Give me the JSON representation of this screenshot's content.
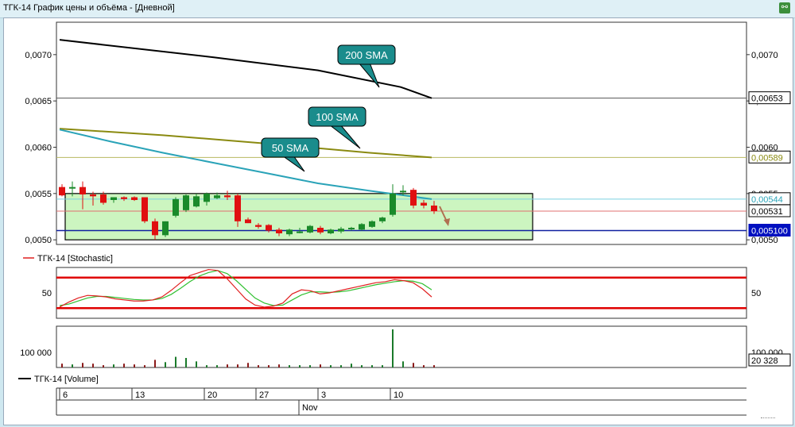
{
  "window": {
    "title": "ТГК-14 График цены и объёма - [Дневной]",
    "icon": "chart-link-icon"
  },
  "colors": {
    "up": "#1a8a2a",
    "down": "#e01010",
    "sma200": "#000000",
    "sma100": "#8a8a10",
    "sma50": "#2aa3b8",
    "box_fill": "#ccf5c0",
    "stoch_k": "#e02020",
    "stoch_d": "#30c030",
    "volume": "#8b1a1a",
    "volume_up": "#1a7a2a",
    "current_bg": "#0010c0"
  },
  "price_panel": {
    "y_ticks": [
      "0,0070",
      "0,0065",
      "0,0060",
      "0,0055",
      "0,0050"
    ],
    "y_range": [
      0.00495,
      0.00735
    ],
    "annotations": {
      "sma200": "200 SMA",
      "sma100": "100 SMA",
      "sma50": "50 SMA"
    },
    "price_tags": {
      "sma200": "0,00653",
      "sma100": "0,00589",
      "sma50": "0,00544",
      "last": "0,00531",
      "support": "0,005100"
    }
  },
  "stoch_panel": {
    "legend": "ТГК-14 [Stochastic]",
    "y_tick": "50"
  },
  "volume_panel": {
    "legend": "ТГК-14 [Volume]",
    "y_tick": "100 000",
    "last_value": "20 328"
  },
  "x_axis": {
    "day_ticks": [
      "6",
      "13",
      "20",
      "27",
      "3",
      "10"
    ],
    "month_label": "Nov"
  },
  "chart_data": {
    "type": "candlestick",
    "n_bars": 36,
    "candles": [
      {
        "o": 0.00557,
        "h": 0.0056,
        "l": 0.00547,
        "c": 0.00548
      },
      {
        "o": 0.00556,
        "h": 0.00563,
        "l": 0.00547,
        "c": 0.00557
      },
      {
        "o": 0.00557,
        "h": 0.00563,
        "l": 0.00533,
        "c": 0.00549
      },
      {
        "o": 0.00549,
        "h": 0.00552,
        "l": 0.00537,
        "c": 0.00547
      },
      {
        "o": 0.00549,
        "h": 0.00552,
        "l": 0.00538,
        "c": 0.0054
      },
      {
        "o": 0.00543,
        "h": 0.00545,
        "l": 0.0054,
        "c": 0.00546
      },
      {
        "o": 0.00546,
        "h": 0.00547,
        "l": 0.00542,
        "c": 0.00544
      },
      {
        "o": 0.00546,
        "h": 0.00547,
        "l": 0.00542,
        "c": 0.00543
      },
      {
        "o": 0.00546,
        "h": 0.00546,
        "l": 0.00518,
        "c": 0.0052
      },
      {
        "o": 0.0052,
        "h": 0.00523,
        "l": 0.005,
        "c": 0.00505
      },
      {
        "o": 0.00505,
        "h": 0.0052,
        "l": 0.00503,
        "c": 0.0052
      },
      {
        "o": 0.00526,
        "h": 0.00546,
        "l": 0.00524,
        "c": 0.00544
      },
      {
        "o": 0.00532,
        "h": 0.00549,
        "l": 0.0053,
        "c": 0.00548
      },
      {
        "o": 0.00536,
        "h": 0.0055,
        "l": 0.00535,
        "c": 0.00547
      },
      {
        "o": 0.00541,
        "h": 0.00551,
        "l": 0.00537,
        "c": 0.0055
      },
      {
        "o": 0.00545,
        "h": 0.00551,
        "l": 0.00544,
        "c": 0.00548
      },
      {
        "o": 0.00548,
        "h": 0.00553,
        "l": 0.00543,
        "c": 0.00546
      },
      {
        "o": 0.00548,
        "h": 0.0055,
        "l": 0.00514,
        "c": 0.0052
      },
      {
        "o": 0.00522,
        "h": 0.00524,
        "l": 0.00518,
        "c": 0.00518
      },
      {
        "o": 0.00516,
        "h": 0.00518,
        "l": 0.00512,
        "c": 0.00514
      },
      {
        "o": 0.00516,
        "h": 0.00517,
        "l": 0.00508,
        "c": 0.0051
      },
      {
        "o": 0.00511,
        "h": 0.00513,
        "l": 0.00504,
        "c": 0.00507
      },
      {
        "o": 0.00506,
        "h": 0.00512,
        "l": 0.00504,
        "c": 0.00511
      },
      {
        "o": 0.00509,
        "h": 0.00513,
        "l": 0.00507,
        "c": 0.00509
      },
      {
        "o": 0.00508,
        "h": 0.00516,
        "l": 0.00507,
        "c": 0.00515
      },
      {
        "o": 0.00513,
        "h": 0.00515,
        "l": 0.00506,
        "c": 0.00508
      },
      {
        "o": 0.00507,
        "h": 0.00512,
        "l": 0.00506,
        "c": 0.00511
      },
      {
        "o": 0.00509,
        "h": 0.00514,
        "l": 0.00507,
        "c": 0.00512
      },
      {
        "o": 0.00512,
        "h": 0.00514,
        "l": 0.0051,
        "c": 0.00513
      },
      {
        "o": 0.00511,
        "h": 0.00518,
        "l": 0.0051,
        "c": 0.00517
      },
      {
        "o": 0.00514,
        "h": 0.00521,
        "l": 0.00513,
        "c": 0.0052
      },
      {
        "o": 0.0052,
        "h": 0.00525,
        "l": 0.00518,
        "c": 0.00524
      },
      {
        "o": 0.00527,
        "h": 0.0056,
        "l": 0.00525,
        "c": 0.0055
      },
      {
        "o": 0.00552,
        "h": 0.00559,
        "l": 0.00548,
        "c": 0.00553
      },
      {
        "o": 0.00554,
        "h": 0.00556,
        "l": 0.00534,
        "c": 0.00537
      },
      {
        "o": 0.0054,
        "h": 0.00543,
        "l": 0.00534,
        "c": 0.00537
      },
      {
        "o": 0.00537,
        "h": 0.00542,
        "l": 0.00528,
        "c": 0.00531
      }
    ],
    "sma200": [
      [
        0,
        0.00716
      ],
      [
        15,
        0.00697
      ],
      [
        25,
        0.00683
      ],
      [
        33,
        0.00665
      ],
      [
        36,
        0.00653
      ]
    ],
    "sma100": [
      [
        0,
        0.0062
      ],
      [
        10,
        0.00613
      ],
      [
        20,
        0.00604
      ],
      [
        30,
        0.00594
      ],
      [
        36,
        0.00589
      ]
    ],
    "sma50": [
      [
        0,
        0.00619
      ],
      [
        5,
        0.00606
      ],
      [
        10,
        0.00594
      ],
      [
        15,
        0.00583
      ],
      [
        20,
        0.00572
      ],
      [
        25,
        0.00561
      ],
      [
        30,
        0.00553
      ],
      [
        36,
        0.00544
      ]
    ],
    "box": {
      "x0": 1,
      "x1": 47,
      "y_top": 0.0055,
      "y_bottom": 0.005
    },
    "support_level": 0.0051,
    "resistance_line": 0.00531,
    "stochastic": {
      "k": [
        22,
        32,
        40,
        45,
        44,
        42,
        38,
        36,
        34,
        34,
        36,
        42,
        55,
        70,
        84,
        90,
        96,
        94,
        78,
        58,
        38,
        26,
        22,
        24,
        30,
        48,
        56,
        54,
        48,
        50,
        54,
        58,
        62,
        66,
        70,
        72,
        76,
        74,
        70,
        58,
        42
      ],
      "d": [
        25,
        28,
        34,
        40,
        43,
        43,
        41,
        39,
        37,
        36,
        36,
        39,
        47,
        59,
        72,
        83,
        90,
        94,
        88,
        74,
        57,
        40,
        30,
        25,
        26,
        36,
        46,
        52,
        52,
        51,
        52,
        54,
        58,
        62,
        66,
        69,
        72,
        74,
        73,
        68,
        56
      ],
      "upper": 80,
      "lower": 20
    },
    "volume": {
      "values": [
        10,
        8,
        12,
        10,
        6,
        8,
        10,
        8,
        6,
        20,
        14,
        28,
        25,
        16,
        6,
        6,
        8,
        8,
        12,
        6,
        6,
        8,
        6,
        6,
        6,
        8,
        6,
        6,
        10,
        6,
        6,
        6,
        100,
        16,
        12,
        6,
        6
      ],
      "units": "relative"
    }
  }
}
